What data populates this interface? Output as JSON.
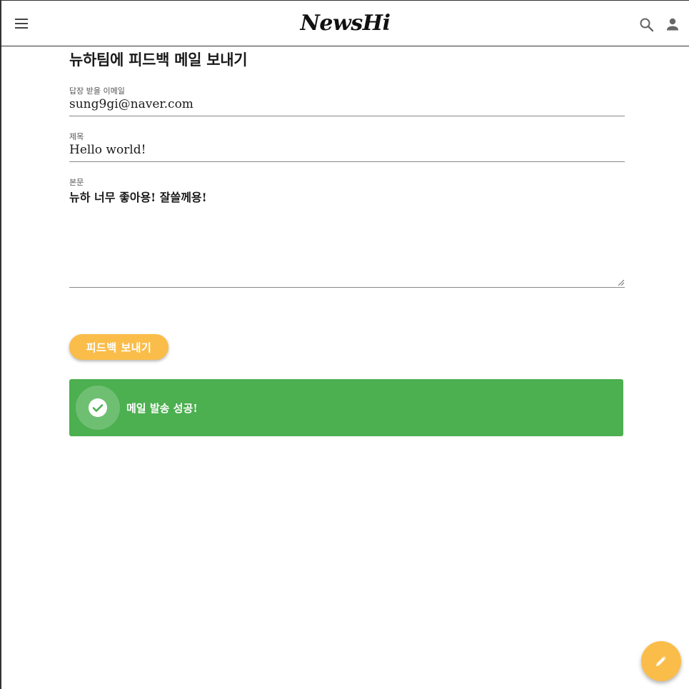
{
  "header": {
    "brand_main": "NewsH",
    "brand_tail": "i",
    "menu_icon": "hamburger-menu-icon",
    "search_icon": "search-icon",
    "account_icon": "person-icon"
  },
  "form": {
    "title": "뉴하팀에 피드백 메일 보내기",
    "email_label": "답장 받을 이메일",
    "email_value": "sung9gi@naver.com",
    "subject_label": "제목",
    "subject_value": "Hello world!",
    "body_label": "본문",
    "body_value": "뉴하 너무 좋아용! 잘쓸께용!",
    "submit_label": "피드백 보내기"
  },
  "alert": {
    "icon": "check-circle-icon",
    "message": "메일 발송 성공!",
    "color": "#4caf50"
  },
  "fab": {
    "icon": "pencil-icon",
    "color": "#fbbd49"
  },
  "colors": {
    "accent": "#fbbd49",
    "brand_dot": "#f7931e",
    "success": "#4caf50"
  }
}
